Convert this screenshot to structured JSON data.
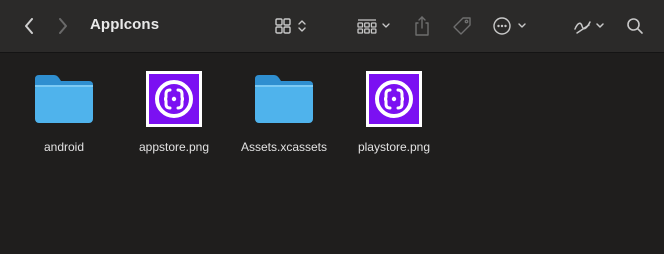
{
  "window": {
    "title": "AppIcons"
  },
  "toolbar": {
    "back": "chevron-left-icon",
    "forward": "chevron-right-icon",
    "view": "grid-view-icon",
    "group": "group-by-icon",
    "share": "share-icon",
    "tag": "tag-icon",
    "action": "more-actions-icon",
    "edit": "markup-pen-icon",
    "search": "search-icon"
  },
  "files": [
    {
      "name": "android",
      "type": "folder"
    },
    {
      "name": "appstore.png",
      "type": "image"
    },
    {
      "name": "Assets.xcassets",
      "type": "folder"
    },
    {
      "name": "playstore.png",
      "type": "image"
    }
  ],
  "colors": {
    "folder": "#4fb3ec",
    "folder_dark": "#2f8fd0",
    "app_icon_purple": "#7b10f2",
    "toolbar_bg": "#2b2a29",
    "window_bg": "#1f1e1d"
  }
}
